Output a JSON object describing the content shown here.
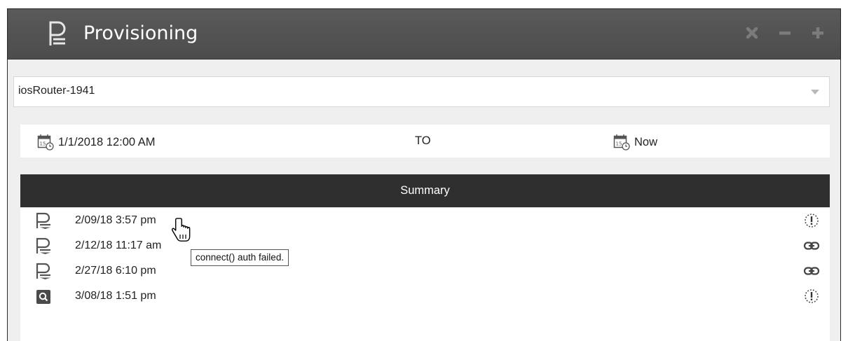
{
  "window": {
    "title": "Provisioning",
    "controls": {
      "close": "close-icon",
      "minimize": "minimize-icon",
      "maximize": "plus-icon"
    }
  },
  "device_select": {
    "value": "iosRouter-1941"
  },
  "date_range": {
    "from": "1/1/2018 12:00 AM",
    "separator": "TO",
    "to": "Now"
  },
  "summary": {
    "header": "Summary",
    "rows": [
      {
        "timestamp": "2/09/18 3:57 pm",
        "type_icon": "template-icon",
        "status_icon": "alert-icon"
      },
      {
        "timestamp": "2/12/18 11:17 am",
        "type_icon": "template-icon",
        "status_icon": "link-icon"
      },
      {
        "timestamp": "2/27/18 6:10 pm",
        "type_icon": "template-icon",
        "status_icon": "link-icon"
      },
      {
        "timestamp": "3/08/18 1:51 pm",
        "type_icon": "inspect-icon",
        "status_icon": "alert-icon"
      }
    ]
  },
  "tooltip": {
    "text": "connect() auth failed."
  },
  "colors": {
    "titlebar": "#4c4c4c",
    "header": "#2f2f2f",
    "icon": "#555555"
  }
}
